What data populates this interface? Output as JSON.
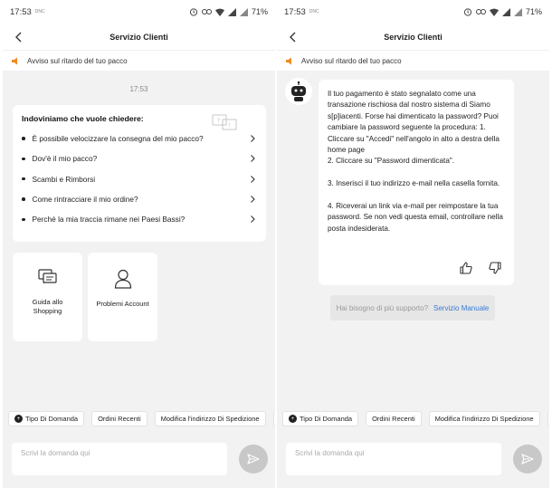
{
  "status": {
    "time": "17:53",
    "small_label": "DNC",
    "battery": "71%"
  },
  "header": {
    "title": "Servizio Clienti"
  },
  "notice": {
    "text": "Avviso sul ritardo del tuo pacco"
  },
  "left": {
    "timestamp": "17:53",
    "faq": {
      "title": "Indoviniamo che vuole chiedere:",
      "items": [
        "È possibile velocizzare la consegna del mio pacco?",
        "Dov'è il mio pacco?",
        "Scambi e Rimborsi",
        "Come rintracciare il mio ordine?",
        "Perché la mia traccia rimane nei Paesi Bassi?"
      ]
    },
    "tiles": [
      {
        "label": "Guida allo Shopping",
        "icon": "chat-bubbles-icon"
      },
      {
        "label": "Problemi Account",
        "icon": "person-icon"
      }
    ]
  },
  "chips": [
    "Tipo Di Domanda",
    "Ordini Recenti",
    "Modifica l'indirizzo Di Spedizione"
  ],
  "input": {
    "placeholder": "Scrivi la domanda qui"
  },
  "right": {
    "answer": {
      "p1": "Il tuo pagamento è stato segnalato come una transazione rischiosa dal nostro sistema di Siamo s[p]iacenti. Forse hai dimenticato la password? Puoi cambiare la password seguente la procedura: 1. Cliccare su \"Accedi\" nell'angolo in alto a destra della home page",
      "p2": "2. Cliccare su \"Password dimenticata\".",
      "p3": "3. Inserisci il tuo indirizzo e-mail nella casella fornita.",
      "p4": "4. Riceverai un link via e-mail per reimpostare la tua password. Se non vedi questa email, controllare nella posta indesiderata."
    },
    "support": {
      "question": "Hai bisogno di più supporto?",
      "link": "Servizio Manuale"
    }
  },
  "colors": {
    "accent_link": "#3a7bd5",
    "notice_icon": "#f08a24",
    "background": "#f2f2f2"
  }
}
